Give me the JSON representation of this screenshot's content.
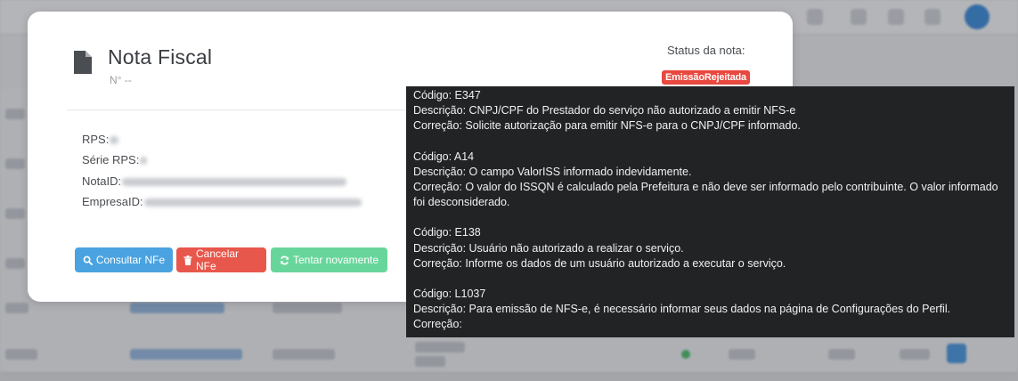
{
  "modal": {
    "title": "Nota Fiscal",
    "number": "N° --",
    "status_label": "Status da nota:",
    "status_badge": "EmissãoRejeitada",
    "colors": {
      "status_badge": "#e8483f",
      "consultar": "#4aa3e0",
      "cancelar": "#e8574b",
      "tentar": "#68d69b"
    },
    "fields": [
      {
        "label": "RPS:"
      },
      {
        "label": "Série RPS:"
      },
      {
        "label": "NotaID:"
      },
      {
        "label": "EmpresaID:"
      }
    ],
    "buttons": {
      "consultar": {
        "label": "Consultar NFe",
        "icon": "search-icon"
      },
      "cancelar": {
        "label": "Cancelar NFe",
        "icon": "trash-icon"
      },
      "tentar": {
        "label": "Tentar novamente",
        "icon": "refresh-icon"
      }
    }
  },
  "tooltip": {
    "errors": [
      {
        "codigo": "Código: E347",
        "descricao": "Descrição: CNPJ/CPF do Prestador do serviço não autorizado a emitir NFS-e",
        "correcao": "Correção: Solicite autorização para emitir NFS-e para o CNPJ/CPF informado."
      },
      {
        "codigo": "Código: A14",
        "descricao": "Descrição: O campo ValorISS informado indevidamente.",
        "correcao": "Correção: O valor do ISSQN é calculado pela Prefeitura e não deve ser informado pelo contribuinte. O valor informado foi desconsiderado."
      },
      {
        "codigo": "Código: E138",
        "descricao": "Descrição: Usuário não autorizado a realizar o serviço.",
        "correcao": "Correção: Informe os dados de um usuário autorizado a executar o serviço."
      },
      {
        "codigo": "Código: L1037",
        "descricao": "Descrição: Para emissão de NFS-e, é necessário informar seus dados na página de Configurações do Perfil.",
        "correcao": "Correção:"
      }
    ]
  }
}
